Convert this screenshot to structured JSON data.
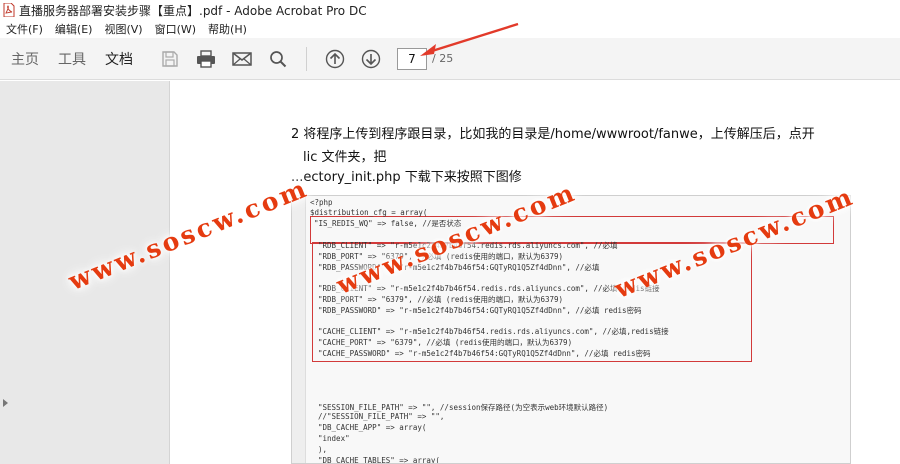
{
  "window": {
    "title": "直播服务器部署安装步骤【重点】.pdf - Adobe Acrobat Pro DC"
  },
  "menu": {
    "items": [
      "文件(F)",
      "编辑(E)",
      "视图(V)",
      "窗口(W)",
      "帮助(H)"
    ]
  },
  "toolbar": {
    "tabs": [
      "主页",
      "工具",
      "文档"
    ],
    "active_tab": "文档",
    "page_current": "7",
    "page_total": "/ 25"
  },
  "document": {
    "line1": "2  将程序上传到程序跟目录，比如我的目录是/home/wwwroot/fanwe，上传解压后，点开",
    "line2": "lic 文件夹，把",
    "line3": "...ectory_init.php 下载下来按照下图修",
    "code": [
      "<?php",
      "$distribution_cfg = array(",
      "    \"IS_REDIS_WQ\"  =>  false,          //是否状态",
      "    \"RDB_CLIENT\"   =>  \"r-m5e1c2f4b7b46f54.redis.rds.aliyuncs.com\", //必填",
      "    \"RDB_PORT\"     =>  \"6379\", //必填 (redis使用的端口，默认为6379)",
      "    \"RDB_PASSWORD\" =>  \"r-m5e1c2f4b7b46f54:GQTyRQ1Q5Zf4dDnn\",  //必填",
      "    \"RDB_CLIENT\"   =>  \"r-m5e1c2f4b7b46f54.redis.rds.aliyuncs.com\", //必填,redis链接",
      "    \"RDB_PORT\"     =>  \"6379\", //必填 (redis使用的端口，默认为6379)",
      "    \"RDB_PASSWORD\" =>  \"r-m5e1c2f4b7b46f54:GQTyRQ1Q5Zf4dDnn\",  //必填 redis密码",
      "    \"CACHE_CLIENT\"  =>  \"r-m5e1c2f4b7b46f54.redis.rds.aliyuncs.com\", //必填,redis链接",
      "    \"CACHE_PORT\"    =>  \"6379\", //必填 (redis使用的端口，默认为6379)",
      "    \"CACHE_PASSWORD\"  =>  \"r-m5e1c2f4b7b46f54:GQTyRQ1Q5Zf4dDnn\",  //必填 redis密码",
      "    \"SESSION_FILE_PATH\" =>  \"\", //session保存路径(为空表示web环境默认路径)",
      "    //\"SESSION_FILE_PATH\"  =>  \"\",",
      "    \"DB_CACHE_APP\"  =>  array(",
      "        \"index\"",
      "    ),",
      "    \"DB_CACHE_TABLES\"  =>  array("
    ]
  },
  "watermarks": [
    "www.soscw.com",
    "www.soscw.com",
    "www.soscw.com"
  ],
  "colors": {
    "watermark": "#e53b10",
    "code_box": "#d23a3a",
    "toolbar_bg": "#f4f4f4",
    "sidebar_bg": "#e8e8e8"
  }
}
